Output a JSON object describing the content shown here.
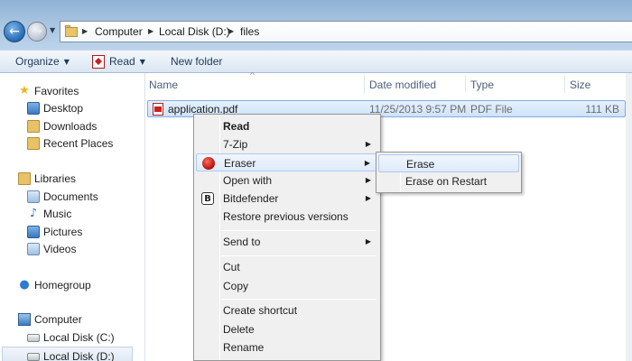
{
  "address_bar": {
    "crumbs": [
      "Computer",
      "Local Disk (D:)",
      "files"
    ]
  },
  "toolbar": {
    "organize": "Organize",
    "read": "Read",
    "new_folder": "New folder"
  },
  "nav_pane": {
    "favorites": {
      "label": "Favorites",
      "items": [
        "Desktop",
        "Downloads",
        "Recent Places"
      ]
    },
    "libraries": {
      "label": "Libraries",
      "items": [
        "Documents",
        "Music",
        "Pictures",
        "Videos"
      ]
    },
    "homegroup": "Homegroup",
    "computer": {
      "label": "Computer",
      "items": [
        "Local Disk (C:)",
        "Local Disk (D:)"
      ],
      "selected": "Local Disk (D:)"
    }
  },
  "columns": [
    "Name",
    "Date modified",
    "Type",
    "Size"
  ],
  "files": [
    {
      "name": "application.pdf",
      "date_modified": "11/25/2013 9:57 PM",
      "type": "PDF File",
      "size": "111 KB",
      "selected": true
    }
  ],
  "context_menu": {
    "items": {
      "read": "Read",
      "seven_zip": "7-Zip",
      "eraser": "Eraser",
      "open_with": "Open with",
      "bitdefender": "Bitdefender",
      "restore": "Restore previous versions",
      "send_to": "Send to",
      "cut": "Cut",
      "copy": "Copy",
      "create_shortcut": "Create shortcut",
      "delete": "Delete",
      "rename": "Rename"
    },
    "highlighted": "Eraser"
  },
  "eraser_submenu": {
    "items": [
      "Erase",
      "Erase on Restart"
    ],
    "highlighted": "Erase"
  },
  "icons": {
    "back": "back-arrow-icon",
    "forward": "forward-arrow-icon",
    "submenu": "chevron-right-icon"
  },
  "colors": {
    "selection_fill": "#cde3fa",
    "selection_border": "#84acdd",
    "toolbar_text": "#1e395b"
  }
}
